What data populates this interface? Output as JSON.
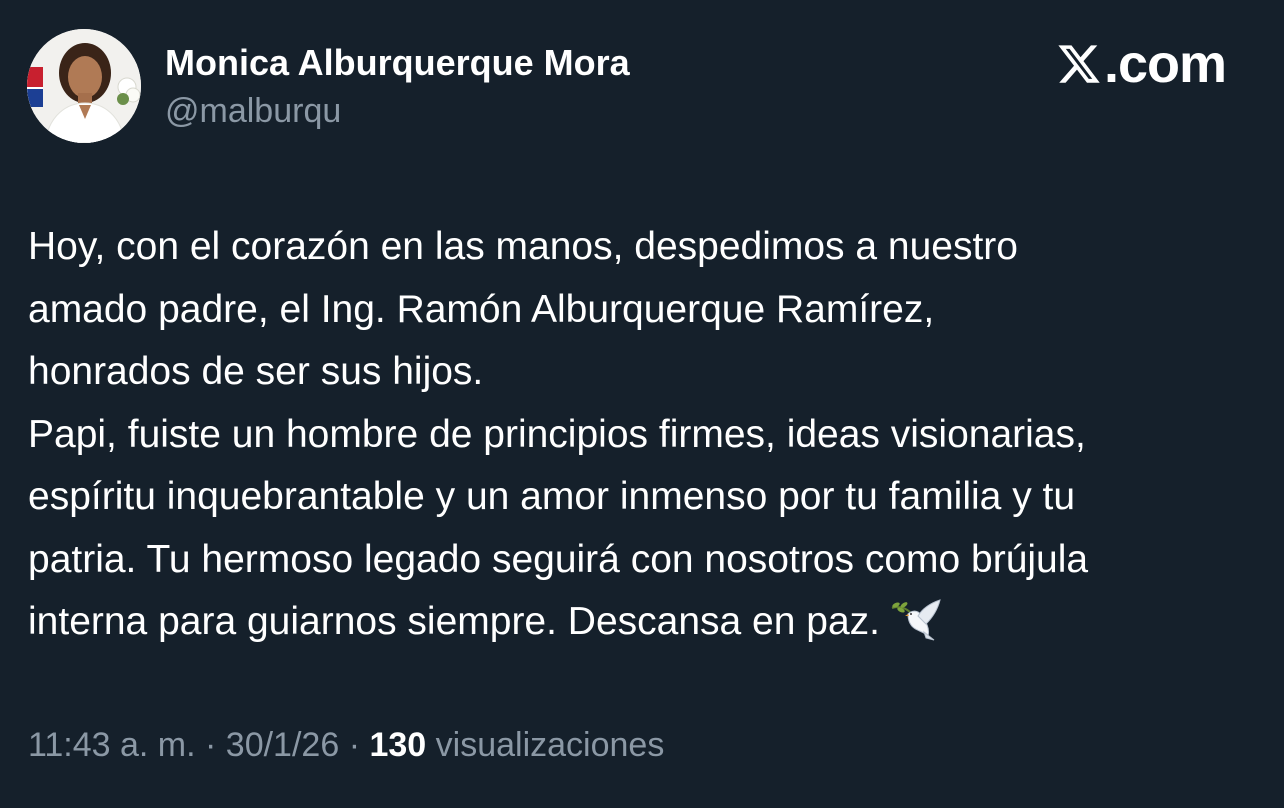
{
  "author": {
    "display_name": "Monica Alburquerque Mora",
    "handle": "@malburqu"
  },
  "brand": {
    "logo_icon": "x-logo-icon",
    "text": ".com"
  },
  "tweet": {
    "lines": [
      "Hoy, con el corazón en las manos, despedimos a nuestro",
      "amado padre, el Ing. Ramón Alburquerque Ramírez,",
      "honrados de ser sus hijos.",
      "Papi, fuiste un hombre de principios firmes, ideas visionarias,",
      "espíritu inquebrantable y un amor inmenso por tu familia y tu",
      "patria. Tu hermoso legado seguirá con nosotros como brújula",
      "interna para guiarnos siempre. Descansa en paz."
    ],
    "emoji_icon": "dove-with-olive-branch-icon"
  },
  "meta": {
    "time": "11:43 a. m.",
    "separator": " · ",
    "date": "30/1/26",
    "views_count": "130",
    "views_label": " visualizaciones"
  },
  "colors": {
    "background": "#15202b",
    "primary_text": "#ffffff",
    "secondary_text": "#8b98a5"
  }
}
